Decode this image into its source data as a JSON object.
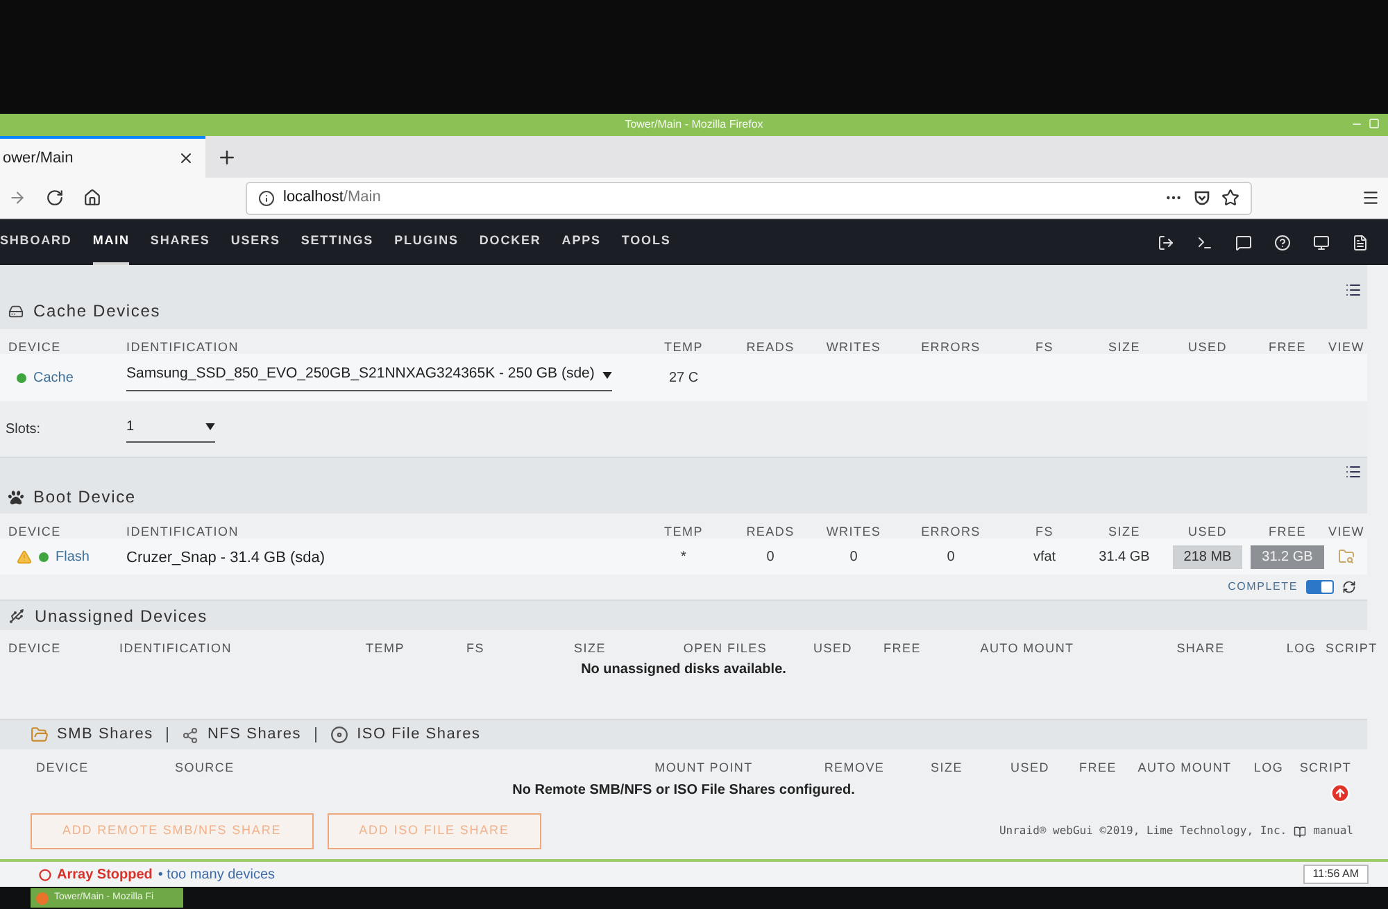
{
  "window": {
    "title": "Tower/Main - Mozilla Firefox"
  },
  "browser": {
    "tab": "ower/Main",
    "url": "**localhost**/Main"
  },
  "nav": [
    {
      "label": "SHBOARD",
      "selected": false
    },
    {
      "label": "MAIN",
      "selected": true
    },
    {
      "label": "SHARES",
      "selected": false
    },
    {
      "label": "USERS",
      "selected": false
    },
    {
      "label": "SETTINGS",
      "selected": false
    },
    {
      "label": "PLUGINS",
      "selected": false
    },
    {
      "label": "DOCKER",
      "selected": false
    },
    {
      "label": "APPS",
      "selected": false
    },
    {
      "label": "TOOLS",
      "selected": false
    }
  ],
  "cache_devices": {
    "title": "Cache Devices",
    "columns": [
      "DEVICE",
      "IDENTIFICATION",
      "TEMP",
      "READS",
      "WRITES",
      "ERRORS",
      "FS",
      "SIZE",
      "USED",
      "FREE",
      "VIEW"
    ],
    "rows": [
      {
        "device": "Cache",
        "color": "#3fa63f",
        "identification": "Samsung_SSD_850_EVO_250GB_S21NNXAG324365K - 250 GB (sde)",
        "temp": "27 C"
      }
    ],
    "slots": {
      "label": "Slots:",
      "value": "1"
    }
  },
  "boot_device": {
    "title": "Boot Device",
    "columns": [
      "DEVICE",
      "IDENTIFICATION",
      "TEMP",
      "READS",
      "WRITES",
      "ERRORS",
      "FS",
      "SIZE",
      "USED",
      "FREE",
      "VIEW"
    ],
    "rows": [
      {
        "device": "Flash",
        "color": "#3fa63f",
        "warning": true,
        "identification": "Cruzer_Snap - 31.4 GB (sda)",
        "temp": "*",
        "reads": "0",
        "writes": "0",
        "errors": "0",
        "fs": "vfat",
        "size": "31.4 GB",
        "used": "218 MB",
        "free": "31.2 GB",
        "view": true
      }
    ],
    "complete": {
      "label": "COMPLETE",
      "on": true
    }
  },
  "unassigned_devices": {
    "title": "Unassigned Devices",
    "columns": [
      "DEVICE",
      "IDENTIFICATION",
      "TEMP",
      "FS",
      "SIZE",
      "OPEN FILES",
      "USED",
      "FREE",
      "AUTO MOUNT",
      "SHARE",
      "LOG",
      "SCRIPT"
    ],
    "empty_message": "No unassigned disks available."
  },
  "remote_shares": {
    "headings": [
      {
        "kind": "smb",
        "label": "SMB Shares"
      },
      {
        "kind": "nfs",
        "label": "NFS Shares"
      },
      {
        "kind": "iso",
        "label": "ISO File Shares"
      }
    ],
    "columns": [
      "DEVICE",
      "SOURCE",
      "MOUNT POINT",
      "REMOVE",
      "SIZE",
      "USED",
      "FREE",
      "AUTO MOUNT",
      "LOG",
      "SCRIPT"
    ],
    "empty_message": "No Remote SMB/NFS or ISO File Shares configured.",
    "buttons": [
      "ADD REMOTE SMB/NFS SHARE",
      "ADD ISO FILE SHARE"
    ]
  },
  "footer": {
    "copyright": "Unraid® webGui ©2019, Lime Technology, Inc.",
    "manual": "manual"
  },
  "status_bar": {
    "array_state": "Array Stopped",
    "message": "• too many devices",
    "clock": "11:56 AM"
  },
  "taskbar": {
    "window": "Tower/Main - Mozilla Fi"
  }
}
